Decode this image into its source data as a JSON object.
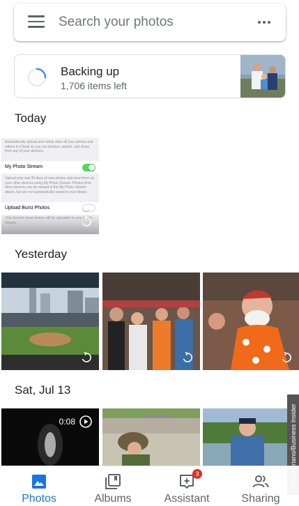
{
  "search": {
    "placeholder": "Search your photos"
  },
  "backup": {
    "title": "Backing up",
    "subtitle": "1,706 items left"
  },
  "sections": [
    {
      "label": "Today"
    },
    {
      "label": "Yesterday"
    },
    {
      "label": "Sat, Jul 13"
    }
  ],
  "settings_shot": {
    "top_note": "Automatically upload and safely store all your photos and videos in iCloud so you can browse, search, and share from any of your devices.",
    "photo_stream_label": "My Photo Stream",
    "photo_stream_note": "Upload your last 30 days of new photos and view them on your other devices using My Photo Stream. Photos from other devices can be viewed in the My Photo Stream album, but are not automatically saved to your library.",
    "burst_label": "Upload Burst Photos",
    "burst_note": "Only favorite burst photos will be uploaded to your Photo Stream."
  },
  "video": {
    "duration": "0:08"
  },
  "nav": {
    "items": [
      {
        "label": "Photos",
        "icon": "photo-icon",
        "active": true
      },
      {
        "label": "Albums",
        "icon": "albums-icon",
        "active": false
      },
      {
        "label": "Assistant",
        "icon": "assistant-icon",
        "active": false,
        "badge": "3"
      },
      {
        "label": "Sharing",
        "icon": "people-icon",
        "active": false
      }
    ]
  },
  "credit": "Ryan Ariano/Business Insider",
  "colors": {
    "accent": "#1a73e8",
    "badge": "#d93025",
    "toggle_on": "#4cd964"
  }
}
